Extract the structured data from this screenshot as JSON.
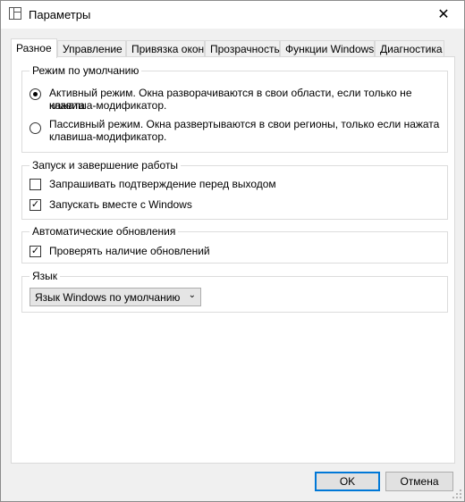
{
  "window": {
    "title": "Параметры",
    "close_glyph": "✕",
    "icon": "app-window-icon"
  },
  "tabs": [
    "Разное",
    "Управление",
    "Привязка окон",
    "Прозрачность",
    "Функции Windows",
    "Диагностика"
  ],
  "active_tab": "Разное",
  "groups": {
    "default_mode": {
      "title": "Режим по умолчанию",
      "active_line1": "Активный режим. Окна разворачиваются в свои области, если только не нажата",
      "active_line2": "клавиша-модификатор.",
      "active_selected": true,
      "passive_line1": "Пассивный режим. Окна развертываются в свои регионы, только если нажата",
      "passive_line2": "клавиша-модификатор.",
      "passive_selected": false
    },
    "startup": {
      "title": "Запуск и завершение работы",
      "confirm_exit": "Запрашивать подтверждение перед выходом",
      "confirm_exit_checked": false,
      "start_with_windows": "Запускать вместе с Windows",
      "start_with_windows_checked": true
    },
    "updates": {
      "title": "Автоматические обновления",
      "check_updates": "Проверять наличие обновлений",
      "check_updates_checked": true
    },
    "language": {
      "title": "Язык",
      "selected": "Язык Windows по умолчанию"
    }
  },
  "buttons": {
    "ok": "OK",
    "cancel": "Отмена"
  },
  "glyphs": {
    "check": "✓",
    "chevron": "⌄"
  },
  "colors": {
    "accent": "#0078d7",
    "panel": "#ffffff",
    "background": "#f0f0f0"
  }
}
